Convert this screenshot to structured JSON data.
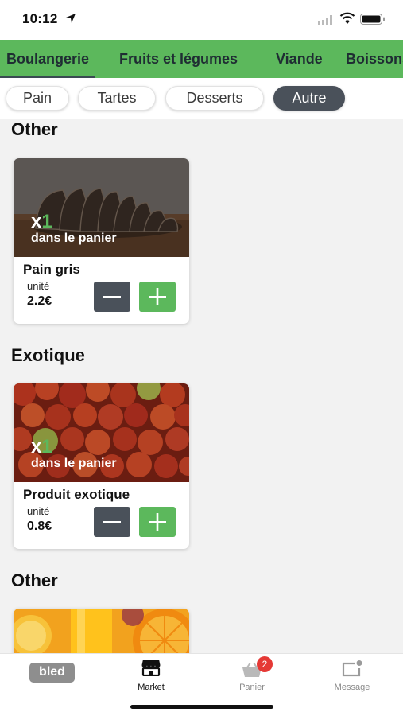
{
  "status": {
    "time": "10:12"
  },
  "categories": [
    {
      "label": "Boulangerie",
      "active": true
    },
    {
      "label": "Fruits et légumes",
      "active": false
    },
    {
      "label": "Viande",
      "active": false
    },
    {
      "label": "Boissons",
      "active": false
    }
  ],
  "subcategories": [
    {
      "label": "Pain",
      "active": false
    },
    {
      "label": "Tartes",
      "active": false
    },
    {
      "label": "Desserts",
      "active": false
    },
    {
      "label": "Autre",
      "active": true
    }
  ],
  "sections": [
    {
      "title": "Other",
      "product": {
        "name": "Pain gris",
        "qty_prefix": "x",
        "qty": "1",
        "in_cart": "dans le panier",
        "unit": "unité",
        "price": "2.2€",
        "image": "bread-photo"
      }
    },
    {
      "title": "Exotique",
      "product": {
        "name": "Produit exotique",
        "qty_prefix": "x",
        "qty": "1",
        "in_cart": "dans le panier",
        "unit": "unité",
        "price": "0.8€",
        "image": "tomatoes-photo"
      }
    },
    {
      "title": "Other",
      "product": {
        "image": "orange-juice-photo"
      }
    }
  ],
  "bottom_nav": {
    "brand": "bled",
    "market": "Market",
    "cart": "Panier",
    "cart_badge": "2",
    "message": "Message"
  },
  "colors": {
    "primary_green": "#5cb85c",
    "dark_slate": "#4a515a",
    "badge_red": "#e53935"
  }
}
